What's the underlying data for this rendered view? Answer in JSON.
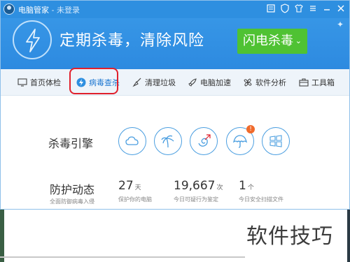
{
  "titlebar": {
    "app_name": "电脑管家",
    "login_status": " - 未登录"
  },
  "banner": {
    "slogan": "定期杀毒，清除风险",
    "scan_button": "闪电杀毒"
  },
  "nav": {
    "items": [
      {
        "label": "首页体检",
        "icon": "monitor-icon"
      },
      {
        "label": "病毒查杀",
        "icon": "bolt-icon",
        "active": true
      },
      {
        "label": "清理垃圾",
        "icon": "broom-icon"
      },
      {
        "label": "电脑加速",
        "icon": "rocket-icon"
      },
      {
        "label": "软件分析",
        "icon": "fan-icon"
      },
      {
        "label": "工具箱",
        "icon": "toolbox-icon"
      }
    ]
  },
  "engines": {
    "label": "杀毒引擎",
    "icons": [
      "cloud-engine-icon",
      "palm-engine-icon",
      "swirl-engine-icon",
      "umbrella-engine-icon",
      "windows-engine-icon"
    ],
    "alert_badge": "!"
  },
  "protection": {
    "label": "防护动态",
    "sublabel": "全面防御病毒入侵",
    "stats": [
      {
        "value": "27",
        "unit": "天",
        "desc": "保护你的电脑"
      },
      {
        "value": "19,667",
        "unit": "次",
        "desc": "今日可疑行为鉴定"
      },
      {
        "value": "1",
        "unit": "个",
        "desc": "今日安全扫描文件"
      }
    ]
  },
  "watermark": "软件技巧",
  "colors": {
    "primary_blue": "#2e8fe0",
    "scan_green": "#4fc233",
    "active_blue": "#1f78d1",
    "highlight_red": "#e0202c"
  }
}
